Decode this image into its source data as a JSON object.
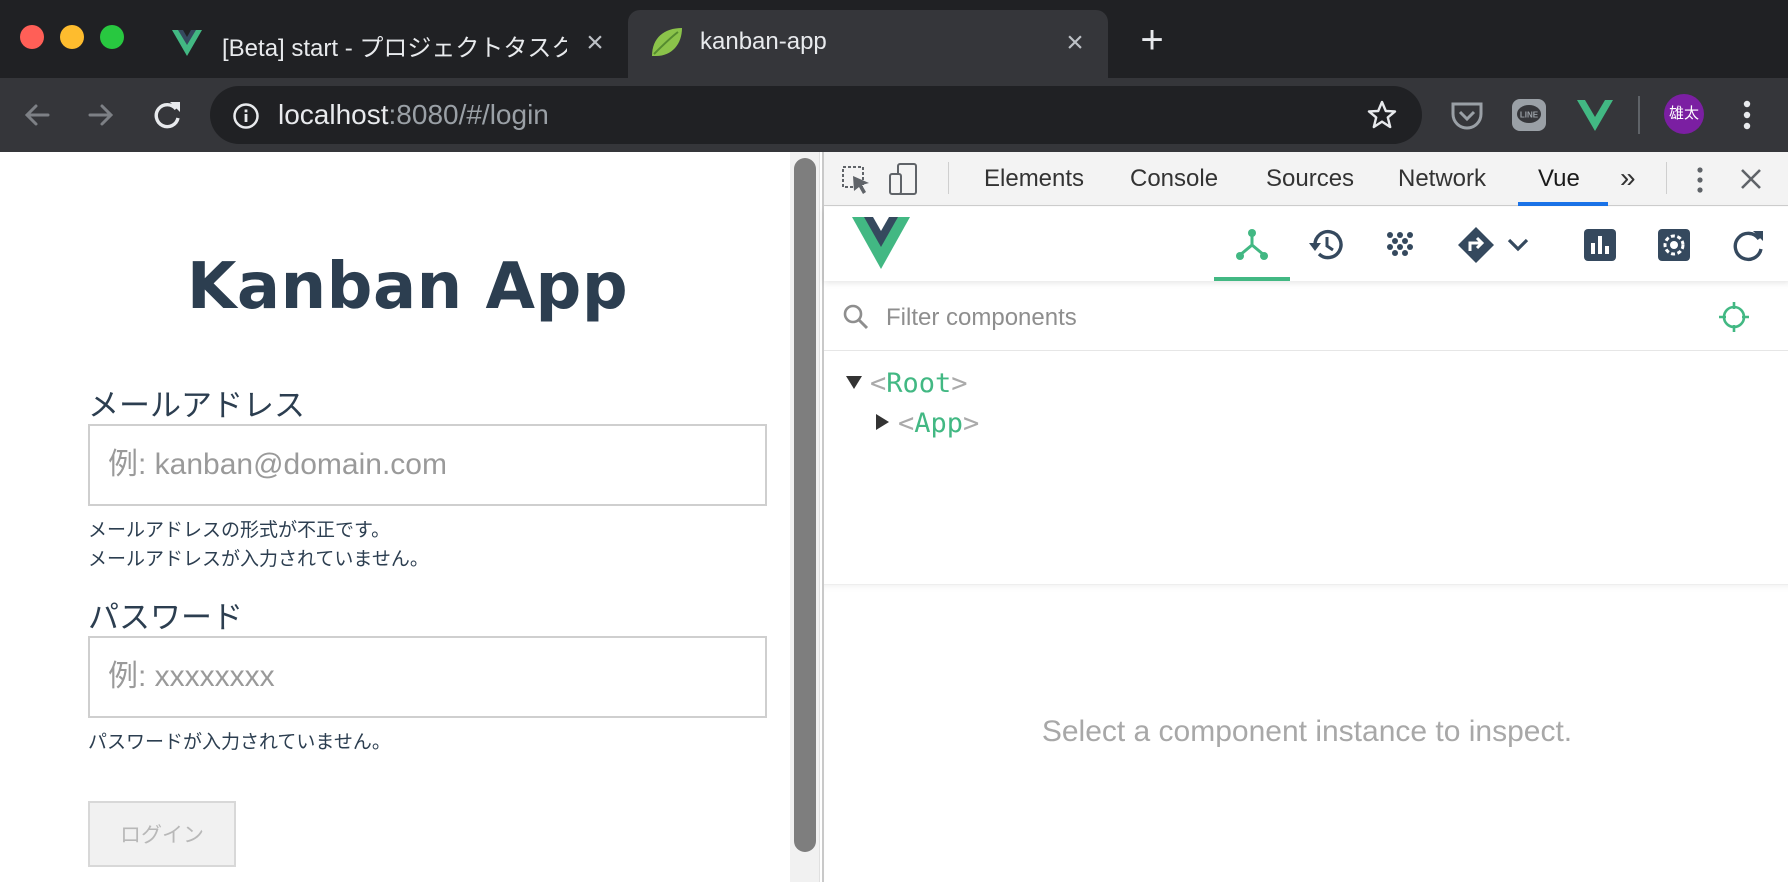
{
  "browser": {
    "tabs": [
      {
        "title": "[Beta] start - プロジェクトタスク",
        "icon": "vue-logo-icon",
        "active": false
      },
      {
        "title": "kanban-app",
        "icon": "leaf-icon",
        "active": true
      }
    ],
    "address": {
      "host": "localhost",
      "rest": ":8080/#/login"
    },
    "avatar_text": "雄太",
    "colors": {
      "vue_green": "#42b883",
      "vue_dark": "#35495e",
      "avatar": "#7b1fa2"
    }
  },
  "page": {
    "title": "Kanban App",
    "email": {
      "label": "メールアドレス",
      "placeholder": "例: kanban@domain.com",
      "errors": [
        "メールアドレスの形式が不正です。",
        "メールアドレスが入力されていません。"
      ]
    },
    "password": {
      "label": "パスワード",
      "placeholder": "例: xxxxxxxx",
      "errors": [
        "パスワードが入力されていません。"
      ]
    },
    "login_button": "ログイン"
  },
  "devtools": {
    "tabs": [
      "Elements",
      "Console",
      "Sources",
      "Network",
      "Vue"
    ],
    "active_tab": "Vue",
    "overflow": "»",
    "vue": {
      "filter_placeholder": "Filter components",
      "tree": [
        {
          "name": "Root",
          "expanded": true
        },
        {
          "name": "App",
          "expanded": false
        }
      ],
      "inspect_message": "Select a component instance to inspect."
    }
  }
}
